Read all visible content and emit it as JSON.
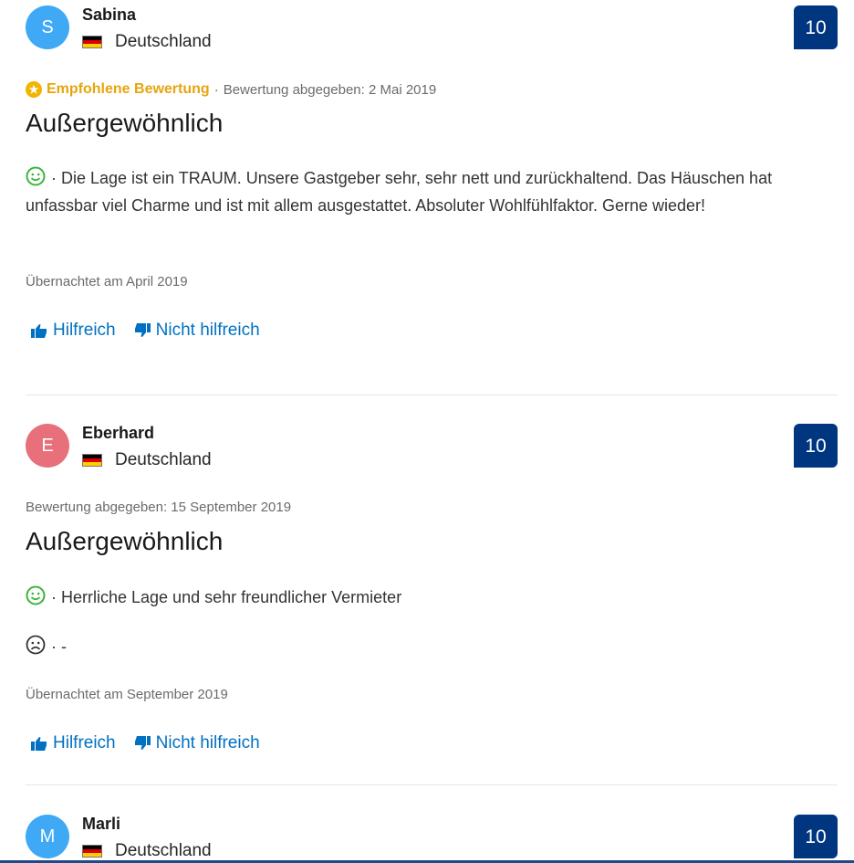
{
  "reviews": [
    {
      "initial": "S",
      "avatar_color": "#3fa9f5",
      "name": "Sabina",
      "country": "Deutschland",
      "score": "10",
      "recommended": "Empfohlene Bewertung",
      "separator": "·",
      "date": "Bewertung abgegeben: 2 Mai 2019",
      "title": "Außergewöhnlich",
      "positive": "· Die Lage ist ein TRAUM. Unsere Gastgeber sehr, sehr nett und zurückhaltend. Das Häuschen hat unfassbar viel Charme und ist mit allem ausgestattet. Absoluter Wohlfühlfaktor. Gerne wieder!",
      "stayed": "Übernachtet am April 2019",
      "helpful": "Hilfreich",
      "not_helpful": "Nicht hilfreich"
    },
    {
      "initial": "E",
      "avatar_color": "#e8707a",
      "name": "Eberhard",
      "country": "Deutschland",
      "score": "10",
      "date": "Bewertung abgegeben: 15 September 2019",
      "title": "Außergewöhnlich",
      "positive": "· Herrliche Lage und sehr freundlicher Vermieter",
      "negative": "· -",
      "stayed": "Übernachtet am September 2019",
      "helpful": "Hilfreich",
      "not_helpful": "Nicht hilfreich"
    },
    {
      "initial": "M",
      "avatar_color": "#3fa9f5",
      "name": "Marli",
      "country": "Deutschland",
      "score": "10"
    }
  ],
  "colors": {
    "score_bg": "#003580",
    "link": "#0071c2",
    "recommended": "#e6a50e",
    "positive_face": "#3db43d"
  },
  "icons": {
    "recommended": "star-badge-icon",
    "positive": "smiley-happy-icon",
    "negative": "smiley-sad-icon",
    "helpful": "thumbs-up-icon",
    "not_helpful": "thumbs-down-icon",
    "flag": "germany-flag-icon"
  }
}
